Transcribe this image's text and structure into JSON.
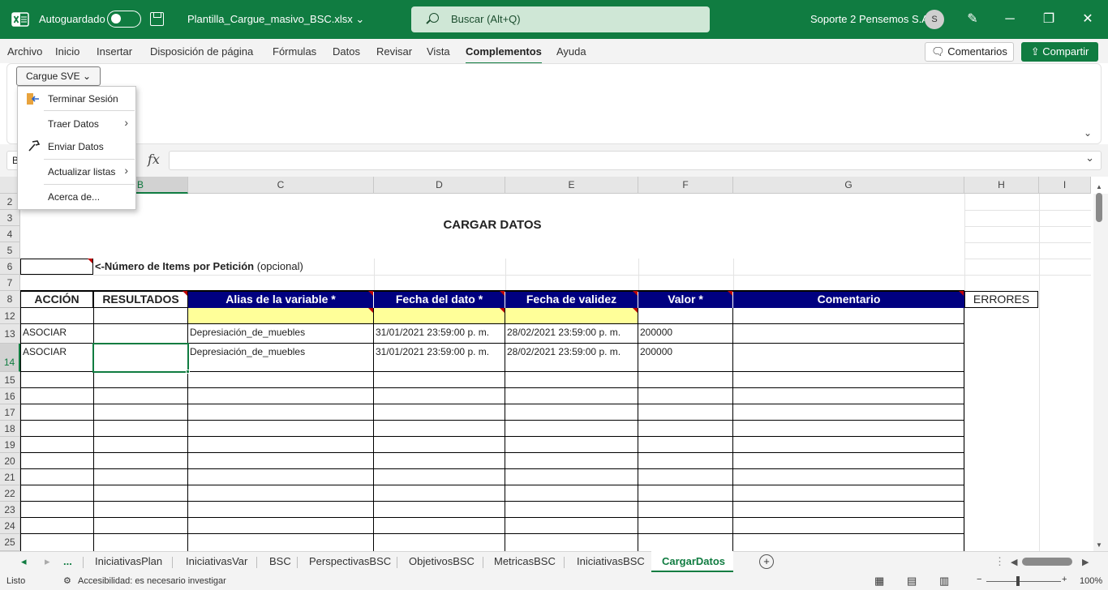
{
  "titlebar": {
    "autosave_label": "Autoguardado",
    "file_name": "Plantilla_Cargue_masivo_BSC.xlsx",
    "search_placeholder": "Buscar (Alt+Q)",
    "user_name": "Soporte 2 Pensemos S.A.",
    "avatar_initial": "S",
    "accent": "#107c41"
  },
  "menu_tabs": [
    "Archivo",
    "Inicio",
    "Insertar",
    "Disposición de página",
    "Fórmulas",
    "Datos",
    "Revisar",
    "Vista",
    "Complementos",
    "Ayuda"
  ],
  "active_tab": "Complementos",
  "actions": {
    "comments": "Comentarios",
    "share": "Compartir"
  },
  "ribbon": {
    "cargue_button": "Cargue SVE"
  },
  "dropdown": {
    "items": [
      "Terminar Sesión",
      "Traer Datos",
      "Enviar Datos",
      "Actualizar listas",
      "Acerca de..."
    ]
  },
  "formula_bar": {
    "name_box": "B",
    "fx": "fx"
  },
  "columns": [
    "B",
    "C",
    "D",
    "E",
    "F",
    "G",
    "H",
    "I"
  ],
  "rows": [
    "2",
    "3",
    "4",
    "5",
    "6",
    "7",
    "8",
    "12",
    "13",
    "14",
    "15",
    "16",
    "17",
    "18",
    "19",
    "20",
    "21",
    "22",
    "23",
    "24",
    "25"
  ],
  "sheet": {
    "title": "CARGAR DATOS",
    "items_label_bold": "<-Número de Items por Petición",
    "items_label_rest": " (opcional)",
    "headers": [
      "ACCIÓN",
      "RESULTADOS",
      "Alias de la variable *",
      "Fecha del dato *",
      "Fecha de validez",
      "Valor *",
      "Comentario"
    ],
    "errors_header": "ERRORES",
    "data_rows": [
      {
        "accion": "ASOCIAR",
        "alias": "Depresiación_de_muebles",
        "fecha_dato": "31/01/2021  23:59:00 p. m.",
        "fecha_validez": "28/02/2021  23:59:00 p. m.",
        "valor": "200000"
      },
      {
        "accion": "ASOCIAR",
        "alias": "Depresiación_de_muebles",
        "fecha_dato": "31/01/2021  23:59:00 p. m.",
        "fecha_validez": "28/02/2021  23:59:00 p. m.",
        "valor": "200000"
      }
    ],
    "header_color": "#000080",
    "highlight_color": "#ffff99"
  },
  "sheet_tabs": [
    "...",
    "IniciativasPlan",
    "IniciativasVar",
    "BSC",
    "PerspectivasBSC",
    "ObjetivosBSC",
    "MetricasBSC",
    "IniciativasBSC",
    "CargarDatos"
  ],
  "active_sheet": "CargarDatos",
  "status": {
    "ready": "Listo",
    "accessibility": "Accesibilidad: es necesario investigar",
    "zoom": "100%"
  }
}
